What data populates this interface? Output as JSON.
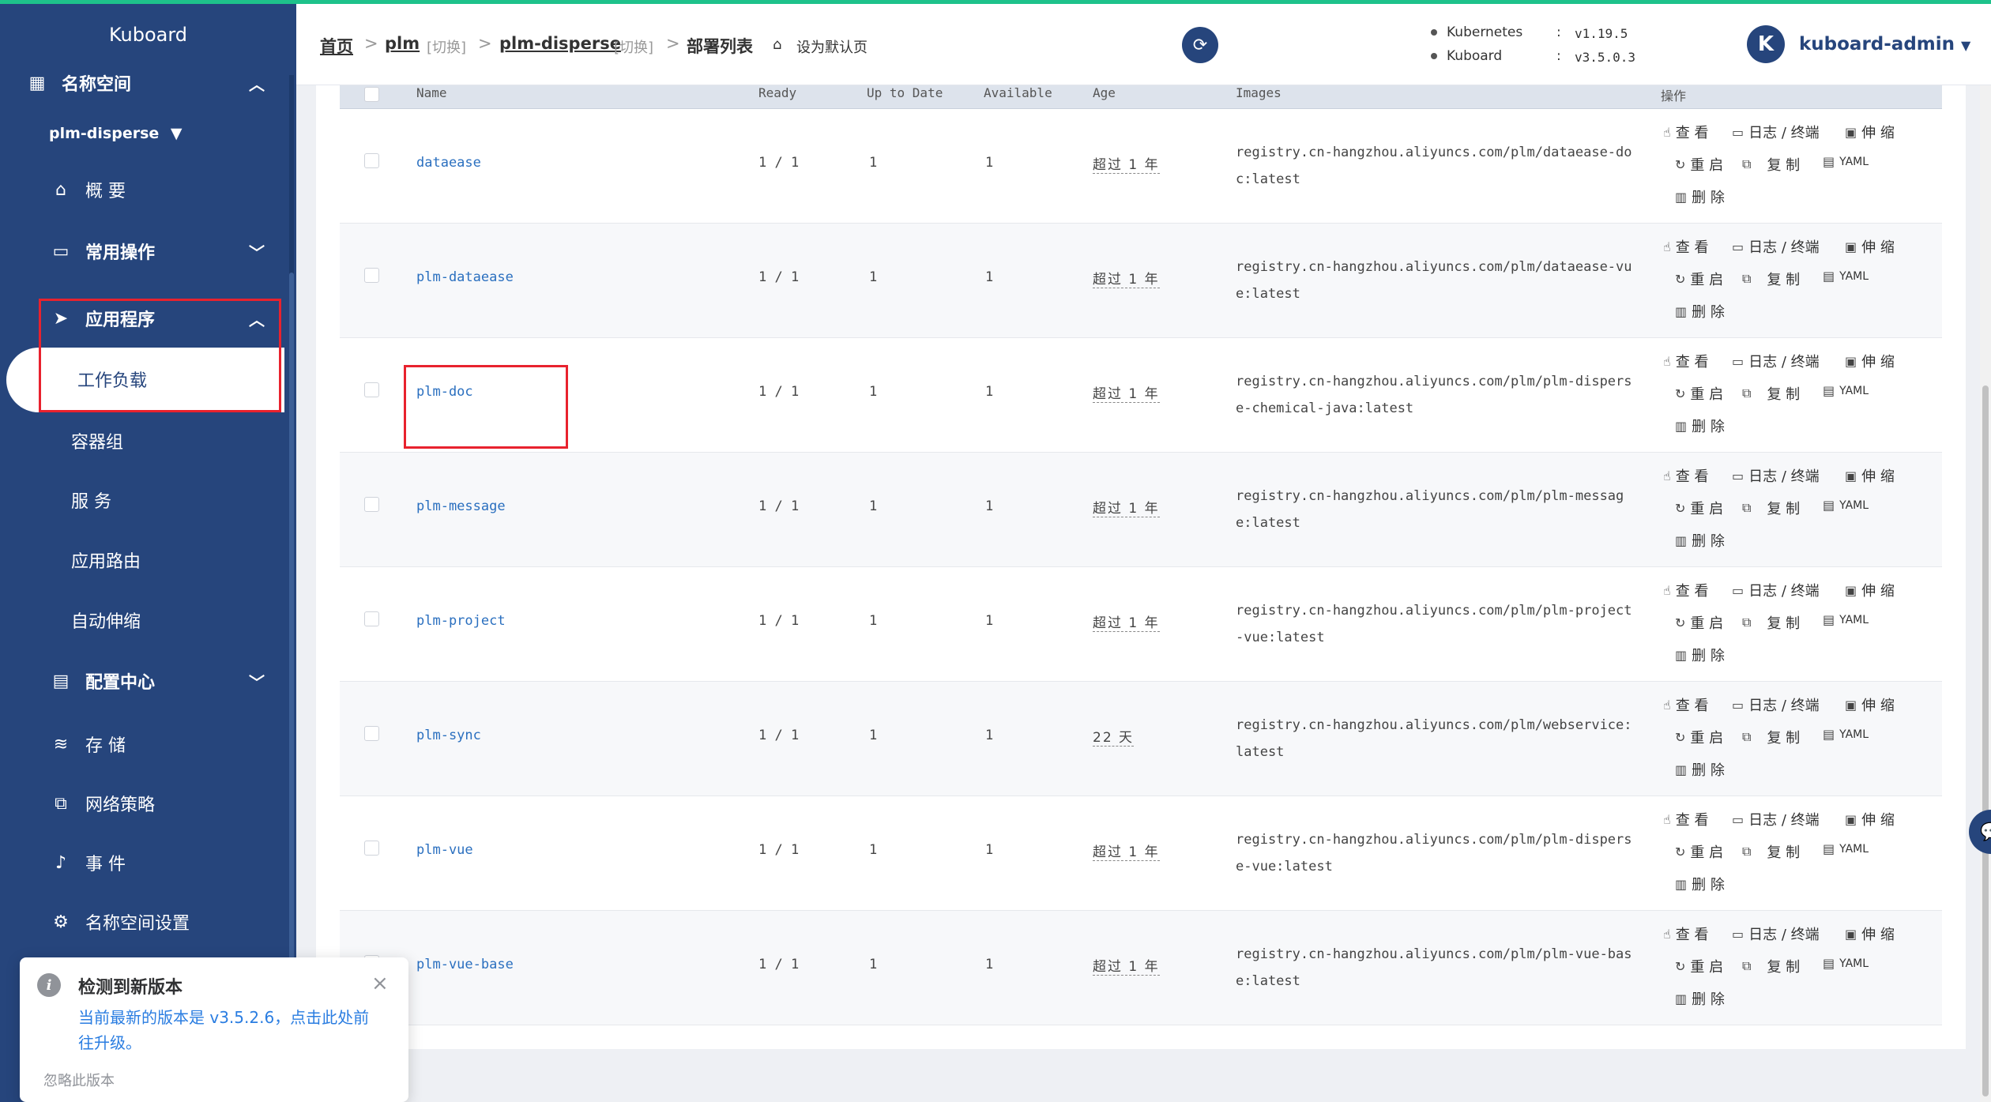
{
  "sidebar": {
    "brand": "Kuboard",
    "namespace_section": "名称空间",
    "namespace_selected": "plm-disperse",
    "items": [
      {
        "label": "概 要"
      },
      {
        "label": "常用操作"
      },
      {
        "label": "应用程序"
      },
      {
        "label": "配置中心"
      },
      {
        "label": "存 储"
      },
      {
        "label": "网络策略"
      },
      {
        "label": "事 件"
      },
      {
        "label": "名称空间设置"
      }
    ],
    "app_sub": [
      "工作负载",
      "容器组",
      "服 务",
      "应用路由",
      "自动伸缩"
    ]
  },
  "header": {
    "breadcrumb": {
      "home": "首页",
      "cluster": "plm",
      "cluster_switch": "[切换]",
      "namespace": "plm-disperse",
      "namespace_switch": "[切换]",
      "current": "部署列表",
      "set_default": "设为默认页"
    },
    "versions": {
      "k8s_label": "Kubernetes",
      "k8s_value": "v1.19.5",
      "kuboard_label": "Kuboard",
      "kuboard_value": "v3.5.0.3",
      "colon": ":"
    },
    "avatar_letter": "K",
    "user": "kuboard-admin"
  },
  "table": {
    "columns": [
      "Name",
      "Ready",
      "Up to Date",
      "Available",
      "Age",
      "Images",
      "操作"
    ],
    "ops": {
      "view": "查 看",
      "logs": "日志 / 终端",
      "scale": "伸 缩",
      "restart": "重 启",
      "copy": "复 制",
      "yaml": "YAML",
      "delete": "删 除"
    },
    "rows": [
      {
        "name": "dataease",
        "ready": "1 / 1",
        "uptodate": "1",
        "available": "1",
        "age": "超过 1 年",
        "image": "registry.cn-hangzhou.aliyuncs.com/plm/dataease-doc:latest"
      },
      {
        "name": "plm-dataease",
        "ready": "1 / 1",
        "uptodate": "1",
        "available": "1",
        "age": "超过 1 年",
        "image": "registry.cn-hangzhou.aliyuncs.com/plm/dataease-vue:latest"
      },
      {
        "name": "plm-doc",
        "ready": "1 / 1",
        "uptodate": "1",
        "available": "1",
        "age": "超过 1 年",
        "image": "registry.cn-hangzhou.aliyuncs.com/plm/plm-disperse-chemical-java:latest"
      },
      {
        "name": "plm-message",
        "ready": "1 / 1",
        "uptodate": "1",
        "available": "1",
        "age": "超过 1 年",
        "image": "registry.cn-hangzhou.aliyuncs.com/plm/plm-message:latest"
      },
      {
        "name": "plm-project",
        "ready": "1 / 1",
        "uptodate": "1",
        "available": "1",
        "age": "超过 1 年",
        "image": "registry.cn-hangzhou.aliyuncs.com/plm/plm-project-vue:latest"
      },
      {
        "name": "plm-sync",
        "ready": "1 / 1",
        "uptodate": "1",
        "available": "1",
        "age": "22 天",
        "image": "registry.cn-hangzhou.aliyuncs.com/plm/webservice:latest"
      },
      {
        "name": "plm-vue",
        "ready": "1 / 1",
        "uptodate": "1",
        "available": "1",
        "age": "超过 1 年",
        "image": "registry.cn-hangzhou.aliyuncs.com/plm/plm-disperse-vue:latest"
      },
      {
        "name": "plm-vue-base",
        "ready": "1 / 1",
        "uptodate": "1",
        "available": "1",
        "age": "超过 1 年",
        "image": "registry.cn-hangzhou.aliyuncs.com/plm/plm-vue-base:latest"
      }
    ]
  },
  "notification": {
    "title": "检测到新版本",
    "message": "当前最新的版本是 v3.5.2.6，点击此处前往升级。",
    "ignore": "忽略此版本"
  },
  "colors": {
    "sidebar_bg": "#26457c",
    "accent_green": "#1ec28b",
    "highlight_red": "#e8222e",
    "link_blue": "#2a6fbf"
  }
}
